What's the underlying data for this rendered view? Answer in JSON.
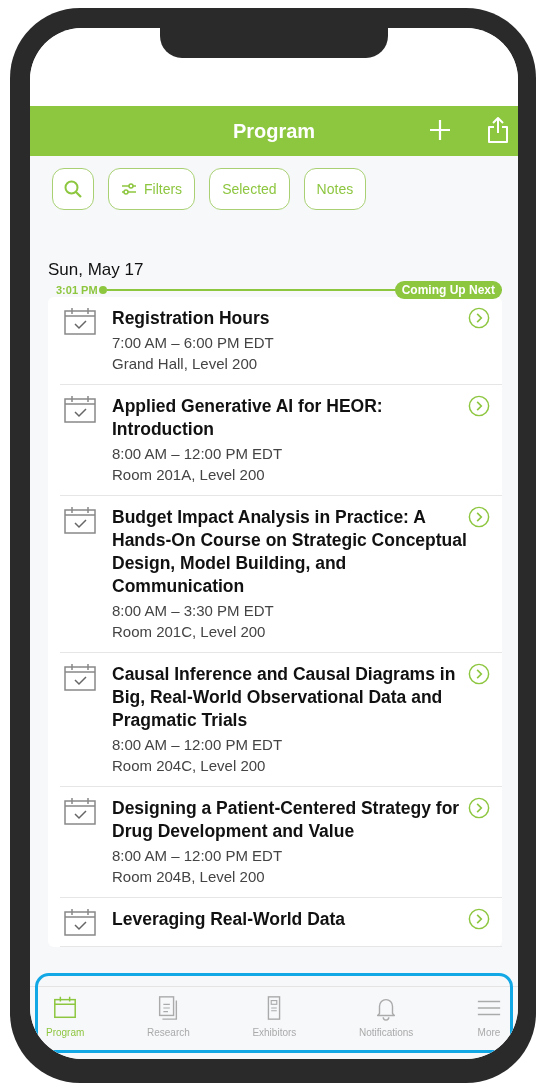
{
  "header": {
    "title": "Program"
  },
  "toolbar": [
    {
      "kind": "search"
    },
    {
      "kind": "filters",
      "label": "Filters"
    },
    {
      "kind": "text",
      "label": "Selected"
    },
    {
      "kind": "text",
      "label": "Notes"
    }
  ],
  "date": "Sun, May 17",
  "now_marker": {
    "time": "3:01 PM",
    "badge": "Coming Up Next"
  },
  "sessions": [
    {
      "title": "Registration Hours",
      "time": "7:00 AM – 6:00 PM EDT",
      "location": "Grand Hall, Level 200"
    },
    {
      "title": "Applied Generative AI for HEOR: Introduction",
      "time": "8:00 AM – 12:00 PM EDT",
      "location": "Room 201A, Level 200"
    },
    {
      "title": "Budget Impact Analysis in Practice: A Hands-On Course on Strategic Conceptual Design, Model Building, and Communication",
      "time": "8:00 AM – 3:30 PM EDT",
      "location": "Room 201C, Level 200"
    },
    {
      "title": "Causal Inference and Causal Diagrams in Big, Real-World Observational Data and Pragmatic Trials",
      "time": "8:00 AM – 12:00 PM EDT",
      "location": "Room 204C, Level 200"
    },
    {
      "title": "Designing a Patient-Centered Strategy for Drug Development and Value",
      "time": "8:00 AM – 12:00 PM EDT",
      "location": "Room 204B, Level 200"
    },
    {
      "title": "Leveraging Real-World Data"
    }
  ],
  "tab_bar": [
    {
      "kind": "program",
      "label": "Program",
      "selected": true
    },
    {
      "kind": "research",
      "label": "Research",
      "selected": false
    },
    {
      "kind": "exhibitors",
      "label": "Exhibitors",
      "selected": false
    },
    {
      "kind": "notifications",
      "label": "Notifications",
      "selected": false
    },
    {
      "kind": "more",
      "label": "More",
      "selected": false
    }
  ]
}
